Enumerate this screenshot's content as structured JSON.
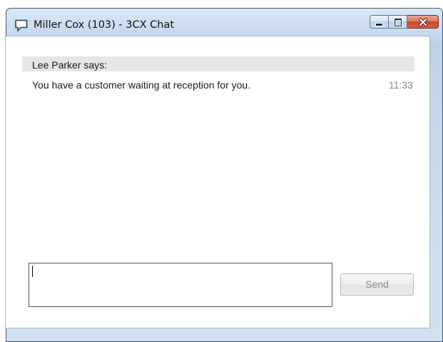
{
  "window": {
    "title": "Miller Cox (103) - 3CX Chat",
    "icon": "chat-bubble-icon",
    "controls": {
      "minimize_icon": "minimize-icon",
      "maximize_icon": "maximize-icon",
      "close_icon": "close-icon"
    }
  },
  "chat": {
    "messages": [
      {
        "sender": "Lee Parker says:",
        "text": "You have a customer waiting at reception for you.",
        "time": "11:33"
      }
    ]
  },
  "compose": {
    "value": "",
    "send_label": "Send"
  },
  "colors": {
    "titlebar": "#c9dbef",
    "close_button": "#c6472a",
    "sender_bar": "#e6e6e6",
    "time_text": "#8a8a8a",
    "send_text": "#8c8c8c"
  }
}
